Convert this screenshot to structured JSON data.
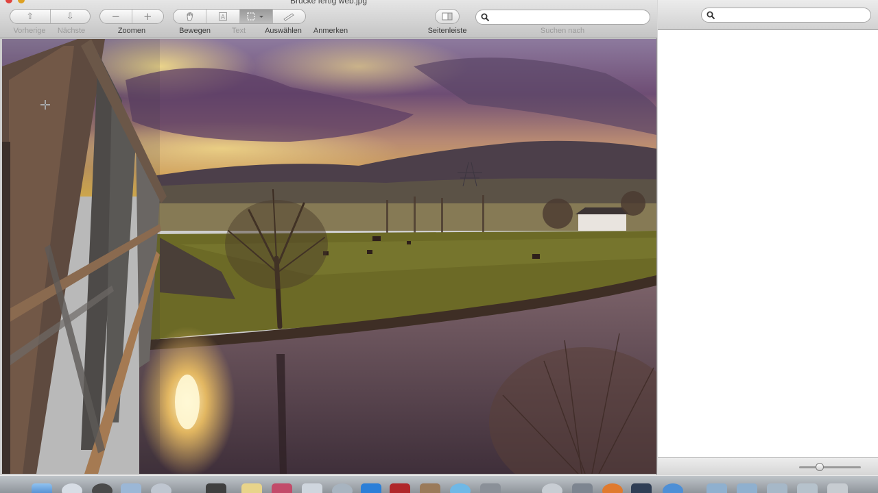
{
  "window": {
    "title": "Brücke fertig web.jpg"
  },
  "toolbar": {
    "previous_label": "Vorherige",
    "next_label": "Nächste",
    "zoom_label": "Zoomen",
    "move_label": "Bewegen",
    "text_label": "Text",
    "select_label": "Auswählen",
    "annotate_label": "Anmerken",
    "sidebar_label": "Seitenleiste",
    "search_label": "Suchen nach",
    "search_value": "",
    "search_placeholder": ""
  },
  "sidebar": {
    "search_value": "",
    "search_placeholder": ""
  },
  "icons": {
    "previous": "arrow-up-icon",
    "next": "arrow-down-icon",
    "zoom_out": "minus-icon",
    "zoom_in": "plus-icon",
    "move": "hand-icon",
    "text": "text-icon",
    "select": "rect-select-icon",
    "annotate": "pen-icon",
    "sidebar": "sidebar-icon",
    "search": "search-icon",
    "cursor": "crosshair-icon"
  },
  "colors": {
    "toolbar_top": "#e6e6e6",
    "toolbar_bottom": "#c4c4c4",
    "sky_purple": "#6e4d74",
    "sunset_yellow": "#e6b94e",
    "grass": "#6c6a26",
    "water": "#5a4550"
  }
}
